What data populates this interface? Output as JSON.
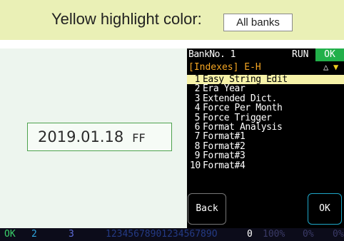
{
  "banner": {
    "label": "Yellow highlight color:",
    "selection": "All banks"
  },
  "display": {
    "date": "2019.01.18",
    "suffix": "FF"
  },
  "screen": {
    "bank": "BankNo. 1",
    "run": "RUN",
    "ok": "OK",
    "index_title": "[Indexes] E-H",
    "tri_up": "△",
    "tri_down": "▼",
    "items": [
      {
        "num": "1",
        "label": "Easy String Edit",
        "selected": true
      },
      {
        "num": "2",
        "label": "Era Year"
      },
      {
        "num": "3",
        "label": "Extended Dict."
      },
      {
        "num": "4",
        "label": "Force Per Month"
      },
      {
        "num": "5",
        "label": "Force Trigger"
      },
      {
        "num": "6",
        "label": "Format Analysis"
      },
      {
        "num": "7",
        "label": "Format#1"
      },
      {
        "num": "8",
        "label": "Format#2"
      },
      {
        "num": "9",
        "label": "Format#3"
      },
      {
        "num": "10",
        "label": "Format#4"
      }
    ],
    "back_label": "Back",
    "ok_label": "OK"
  },
  "status": {
    "ok": "OK",
    "bank2": "2",
    "bank3": "3",
    "digits": "1234567890123456789O",
    "zero": "0",
    "pct100": "100%",
    "pct_a": "0%",
    "pct_b": "0%"
  },
  "colors": {
    "banner_bg": "#eaf0b6",
    "left_bg": "#edf5ee",
    "date_border": "#4ea24e",
    "highlight": "#f6f2a8",
    "index_title": "#f5a623",
    "ok_green": "#22b04a",
    "ok_button_border": "#1ea6c8"
  }
}
